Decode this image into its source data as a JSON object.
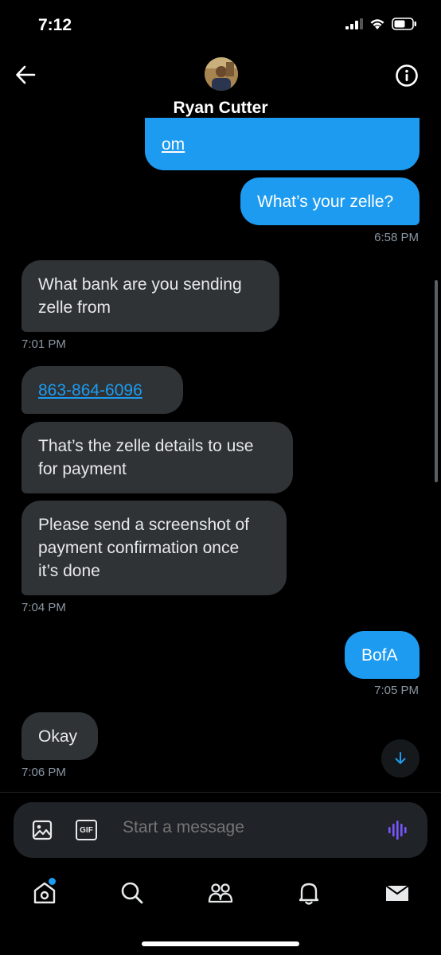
{
  "status_bar": {
    "time": "7:12"
  },
  "header": {
    "title": "Ryan Cutter"
  },
  "messages": [
    {
      "type": "outgoing",
      "text": "om"
    },
    {
      "type": "outgoing",
      "text": "What’s your zelle?"
    },
    {
      "type": "timestamp",
      "text": "6:58 PM"
    },
    {
      "type": "incoming",
      "line1": "What bank are you sending",
      "line2": "zelle from"
    },
    {
      "type": "timestamp",
      "text": "7:01 PM"
    },
    {
      "type": "incoming",
      "text": "863-864-6096"
    },
    {
      "type": "incoming",
      "line1": "That’s the zelle details to use",
      "line2": "for payment"
    },
    {
      "type": "incoming",
      "line1": "Please send a screenshot of",
      "line2": "payment confirmation once",
      "line3": "it’s done"
    },
    {
      "type": "timestamp",
      "text": "7:04 PM"
    },
    {
      "type": "outgoing",
      "text": "BofA"
    },
    {
      "type": "timestamp",
      "text": "7:05 PM"
    },
    {
      "type": "incoming",
      "text": "Okay"
    },
    {
      "type": "timestamp",
      "text": "7:06 PM"
    }
  ],
  "composer": {
    "placeholder": "Start a message",
    "gif_label": "GIF"
  },
  "colors": {
    "accent": "#1d9bf0",
    "bubble_in": "#2f3336",
    "background": "#000000",
    "voice": "#7856ff"
  },
  "icons": [
    "back-arrow-icon",
    "info-icon",
    "image-icon",
    "gif-icon",
    "voice-icon",
    "home-icon",
    "search-icon",
    "communities-icon",
    "notifications-icon",
    "messages-icon",
    "scroll-down-icon"
  ]
}
